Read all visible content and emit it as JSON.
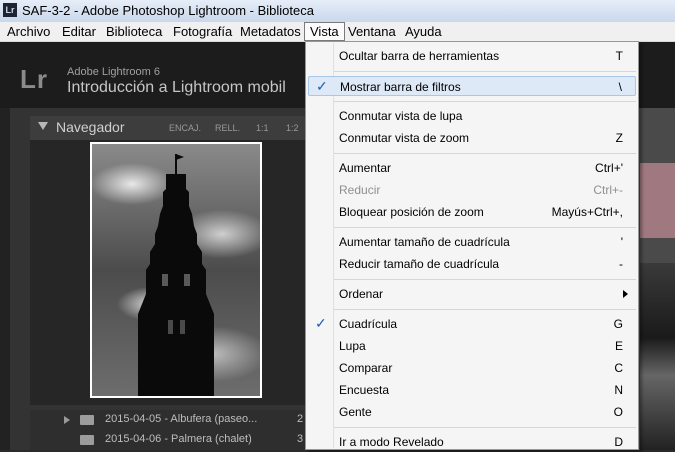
{
  "window": {
    "title": "SAF-3-2 - Adobe Photoshop Lightroom - Biblioteca",
    "app_icon": "Lr"
  },
  "menubar": [
    "Archivo",
    "Editar",
    "Biblioteca",
    "Fotografía",
    "Metadatos",
    "Vista",
    "Ventana",
    "Ayuda"
  ],
  "identity": {
    "logo": "Lr",
    "version": "Adobe Lightroom 6",
    "catalog": "Introducción a Lightroom mobil"
  },
  "navigator": {
    "title": "Navegador",
    "zoom_options": [
      "ENCAJ.",
      "RELL.",
      "1:1",
      "1:2"
    ]
  },
  "folders": [
    {
      "name": "2015-04-05 - Albufera (paseo...",
      "count": "2"
    },
    {
      "name": "2015-04-06 - Palmera (chalet)",
      "count": "3"
    }
  ],
  "vista_menu": {
    "hide_toolbar": {
      "label": "Ocultar barra de herramientas",
      "shortcut": "T"
    },
    "show_filter_bar": {
      "label": "Mostrar barra de filtros",
      "shortcut": "\\"
    },
    "toggle_loupe": {
      "label": "Conmutar vista de lupa",
      "shortcut": ""
    },
    "toggle_zoom": {
      "label": "Conmutar vista de zoom",
      "shortcut": "Z"
    },
    "zoom_in": {
      "label": "Aumentar",
      "shortcut": "Ctrl+'"
    },
    "zoom_out": {
      "label": "Reducir",
      "shortcut": "Ctrl+-"
    },
    "lock_zoom": {
      "label": "Bloquear posición de zoom",
      "shortcut": "Mayús+Ctrl+,"
    },
    "increase_grid": {
      "label": "Aumentar tamaño de cuadrícula",
      "shortcut": "'"
    },
    "decrease_grid": {
      "label": "Reducir tamaño de cuadrícula",
      "shortcut": "-"
    },
    "sort": {
      "label": "Ordenar",
      "shortcut": ""
    },
    "grid": {
      "label": "Cuadrícula",
      "shortcut": "G"
    },
    "loupe": {
      "label": "Lupa",
      "shortcut": "E"
    },
    "compare": {
      "label": "Comparar",
      "shortcut": "C"
    },
    "survey": {
      "label": "Encuesta",
      "shortcut": "N"
    },
    "people": {
      "label": "Gente",
      "shortcut": "O"
    },
    "develop": {
      "label": "Ir a modo Revelado",
      "shortcut": "D"
    }
  },
  "checkmark": "✓"
}
